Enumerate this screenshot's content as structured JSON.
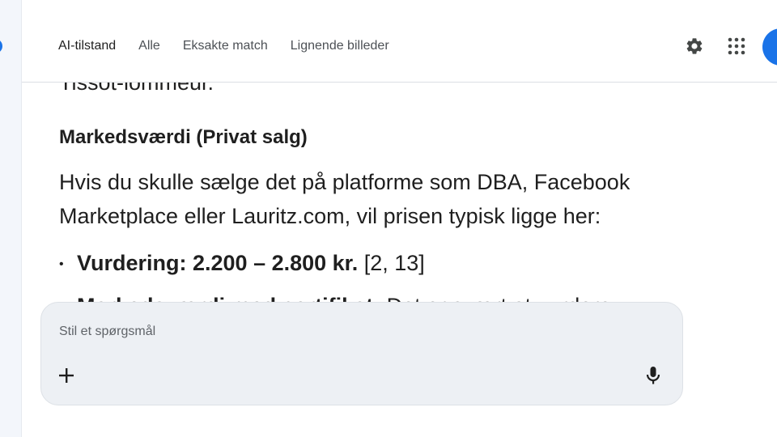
{
  "tabs": [
    {
      "label": "AI-tilstand",
      "active": true
    },
    {
      "label": "Alle"
    },
    {
      "label": "Eksakte match"
    },
    {
      "label": "Lignende billeder"
    }
  ],
  "icons": {
    "settings": "gear-icon",
    "apps": "apps-grid-icon",
    "add": "plus-icon",
    "voice": "microphone-icon"
  },
  "colors": {
    "accent": "#1a73e8",
    "input_bg": "#edf0f4"
  },
  "content": {
    "cut_line": "Tissot-lommeur.",
    "heading": "Markedsværdi (Privat salg)",
    "paragraph": "Hvis du skulle sælge det på platforme som DBA, Facebook Marketplace eller Lauritz.com, vil prisen typisk ligge her:",
    "bullet1_bold": "Vurdering: 2.200 – 2.800 kr.",
    "bullet1_ref": " [2, 13]",
    "bullet2_bold": "Markedsværdi med certifikat:",
    "bullet2_rest": " Det er svært at vurdere"
  },
  "prompt": {
    "placeholder": "Stil et spørgsmål"
  }
}
